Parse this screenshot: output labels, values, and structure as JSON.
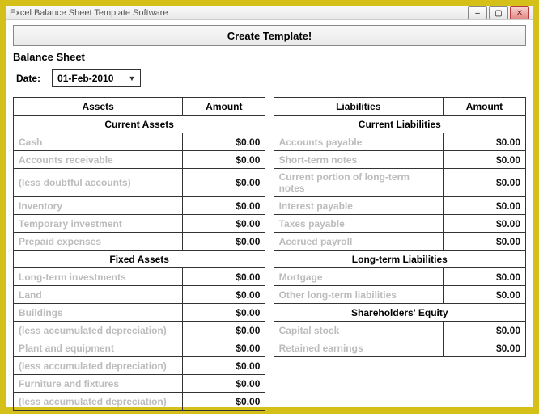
{
  "window": {
    "title": "Excel Balance Sheet Template Software"
  },
  "buttons": {
    "create": "Create Template!"
  },
  "labels": {
    "sheet_title": "Balance Sheet",
    "date_label": "Date:"
  },
  "date": {
    "value": "01-Feb-2010"
  },
  "table": {
    "headers": {
      "assets": "Assets",
      "liabilities": "Liabilities",
      "amount": "Amount"
    },
    "groups": {
      "current_assets": "Current Assets",
      "current_liabilities": "Current Liabilities",
      "fixed_assets": "Fixed Assets",
      "long_term_liabilities": "Long-term Liabilities",
      "shareholders_equity": "Shareholders' Equity"
    },
    "rows": {
      "cash": "Cash",
      "accounts_receivable": "Accounts receivable",
      "less_doubtful": "(less doubtful accounts)",
      "inventory": "Inventory",
      "temp_invest": "Temporary investment",
      "prepaid_exp": "Prepaid expenses",
      "lt_invest": "Long-term investments",
      "land": "Land",
      "buildings": "Buildings",
      "less_dep1": "(less accumulated depreciation)",
      "plant_equip": "Plant and equipment",
      "less_dep2": "(less accumulated depreciation)",
      "furniture": "Furniture and fixtures",
      "less_dep3": "(less accumulated depreciation)",
      "acct_payable": "Accounts payable",
      "short_notes": "Short-term notes",
      "cur_lt_notes": "Current portion of long-term notes",
      "int_payable": "Interest payable",
      "taxes_payable": "Taxes payable",
      "accrued_payroll": "Accrued payroll",
      "mortgage": "Mortgage",
      "other_lt_liab": "Other long-term liabilities",
      "capital_stock": "Capital stock",
      "retained_earn": "Retained earnings"
    },
    "zero": "$0.00"
  }
}
